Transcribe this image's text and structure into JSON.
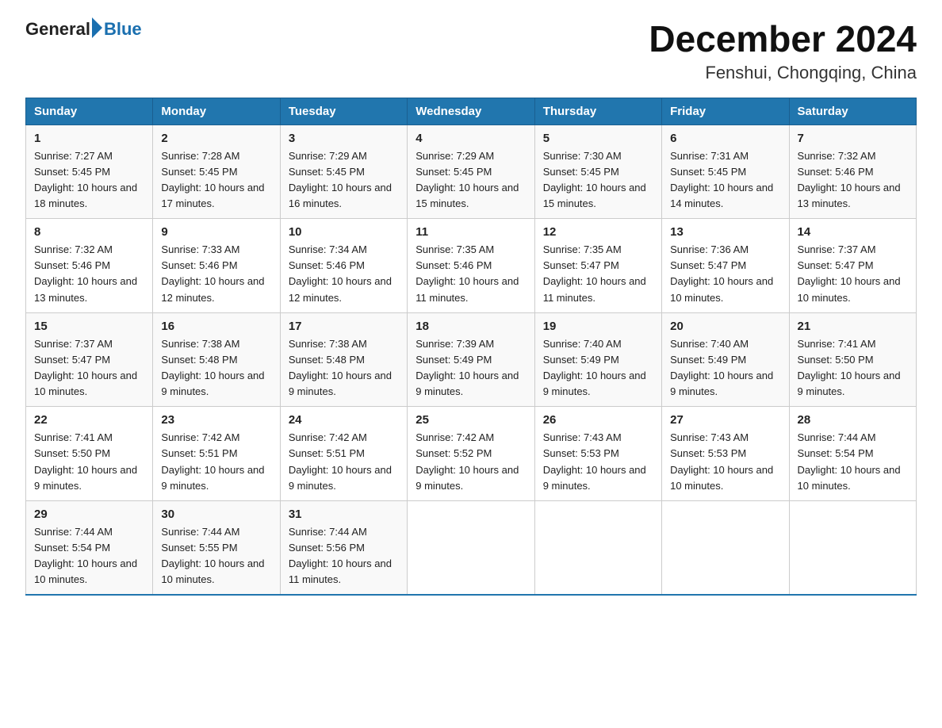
{
  "header": {
    "logo_general": "General",
    "logo_blue": "Blue",
    "title": "December 2024",
    "subtitle": "Fenshui, Chongqing, China"
  },
  "days_of_week": [
    "Sunday",
    "Monday",
    "Tuesday",
    "Wednesday",
    "Thursday",
    "Friday",
    "Saturday"
  ],
  "weeks": [
    [
      {
        "day": "1",
        "sunrise": "7:27 AM",
        "sunset": "5:45 PM",
        "daylight": "10 hours and 18 minutes."
      },
      {
        "day": "2",
        "sunrise": "7:28 AM",
        "sunset": "5:45 PM",
        "daylight": "10 hours and 17 minutes."
      },
      {
        "day": "3",
        "sunrise": "7:29 AM",
        "sunset": "5:45 PM",
        "daylight": "10 hours and 16 minutes."
      },
      {
        "day": "4",
        "sunrise": "7:29 AM",
        "sunset": "5:45 PM",
        "daylight": "10 hours and 15 minutes."
      },
      {
        "day": "5",
        "sunrise": "7:30 AM",
        "sunset": "5:45 PM",
        "daylight": "10 hours and 15 minutes."
      },
      {
        "day": "6",
        "sunrise": "7:31 AM",
        "sunset": "5:45 PM",
        "daylight": "10 hours and 14 minutes."
      },
      {
        "day": "7",
        "sunrise": "7:32 AM",
        "sunset": "5:46 PM",
        "daylight": "10 hours and 13 minutes."
      }
    ],
    [
      {
        "day": "8",
        "sunrise": "7:32 AM",
        "sunset": "5:46 PM",
        "daylight": "10 hours and 13 minutes."
      },
      {
        "day": "9",
        "sunrise": "7:33 AM",
        "sunset": "5:46 PM",
        "daylight": "10 hours and 12 minutes."
      },
      {
        "day": "10",
        "sunrise": "7:34 AM",
        "sunset": "5:46 PM",
        "daylight": "10 hours and 12 minutes."
      },
      {
        "day": "11",
        "sunrise": "7:35 AM",
        "sunset": "5:46 PM",
        "daylight": "10 hours and 11 minutes."
      },
      {
        "day": "12",
        "sunrise": "7:35 AM",
        "sunset": "5:47 PM",
        "daylight": "10 hours and 11 minutes."
      },
      {
        "day": "13",
        "sunrise": "7:36 AM",
        "sunset": "5:47 PM",
        "daylight": "10 hours and 10 minutes."
      },
      {
        "day": "14",
        "sunrise": "7:37 AM",
        "sunset": "5:47 PM",
        "daylight": "10 hours and 10 minutes."
      }
    ],
    [
      {
        "day": "15",
        "sunrise": "7:37 AM",
        "sunset": "5:47 PM",
        "daylight": "10 hours and 10 minutes."
      },
      {
        "day": "16",
        "sunrise": "7:38 AM",
        "sunset": "5:48 PM",
        "daylight": "10 hours and 9 minutes."
      },
      {
        "day": "17",
        "sunrise": "7:38 AM",
        "sunset": "5:48 PM",
        "daylight": "10 hours and 9 minutes."
      },
      {
        "day": "18",
        "sunrise": "7:39 AM",
        "sunset": "5:49 PM",
        "daylight": "10 hours and 9 minutes."
      },
      {
        "day": "19",
        "sunrise": "7:40 AM",
        "sunset": "5:49 PM",
        "daylight": "10 hours and 9 minutes."
      },
      {
        "day": "20",
        "sunrise": "7:40 AM",
        "sunset": "5:49 PM",
        "daylight": "10 hours and 9 minutes."
      },
      {
        "day": "21",
        "sunrise": "7:41 AM",
        "sunset": "5:50 PM",
        "daylight": "10 hours and 9 minutes."
      }
    ],
    [
      {
        "day": "22",
        "sunrise": "7:41 AM",
        "sunset": "5:50 PM",
        "daylight": "10 hours and 9 minutes."
      },
      {
        "day": "23",
        "sunrise": "7:42 AM",
        "sunset": "5:51 PM",
        "daylight": "10 hours and 9 minutes."
      },
      {
        "day": "24",
        "sunrise": "7:42 AM",
        "sunset": "5:51 PM",
        "daylight": "10 hours and 9 minutes."
      },
      {
        "day": "25",
        "sunrise": "7:42 AM",
        "sunset": "5:52 PM",
        "daylight": "10 hours and 9 minutes."
      },
      {
        "day": "26",
        "sunrise": "7:43 AM",
        "sunset": "5:53 PM",
        "daylight": "10 hours and 9 minutes."
      },
      {
        "day": "27",
        "sunrise": "7:43 AM",
        "sunset": "5:53 PM",
        "daylight": "10 hours and 10 minutes."
      },
      {
        "day": "28",
        "sunrise": "7:44 AM",
        "sunset": "5:54 PM",
        "daylight": "10 hours and 10 minutes."
      }
    ],
    [
      {
        "day": "29",
        "sunrise": "7:44 AM",
        "sunset": "5:54 PM",
        "daylight": "10 hours and 10 minutes."
      },
      {
        "day": "30",
        "sunrise": "7:44 AM",
        "sunset": "5:55 PM",
        "daylight": "10 hours and 10 minutes."
      },
      {
        "day": "31",
        "sunrise": "7:44 AM",
        "sunset": "5:56 PM",
        "daylight": "10 hours and 11 minutes."
      },
      null,
      null,
      null,
      null
    ]
  ]
}
